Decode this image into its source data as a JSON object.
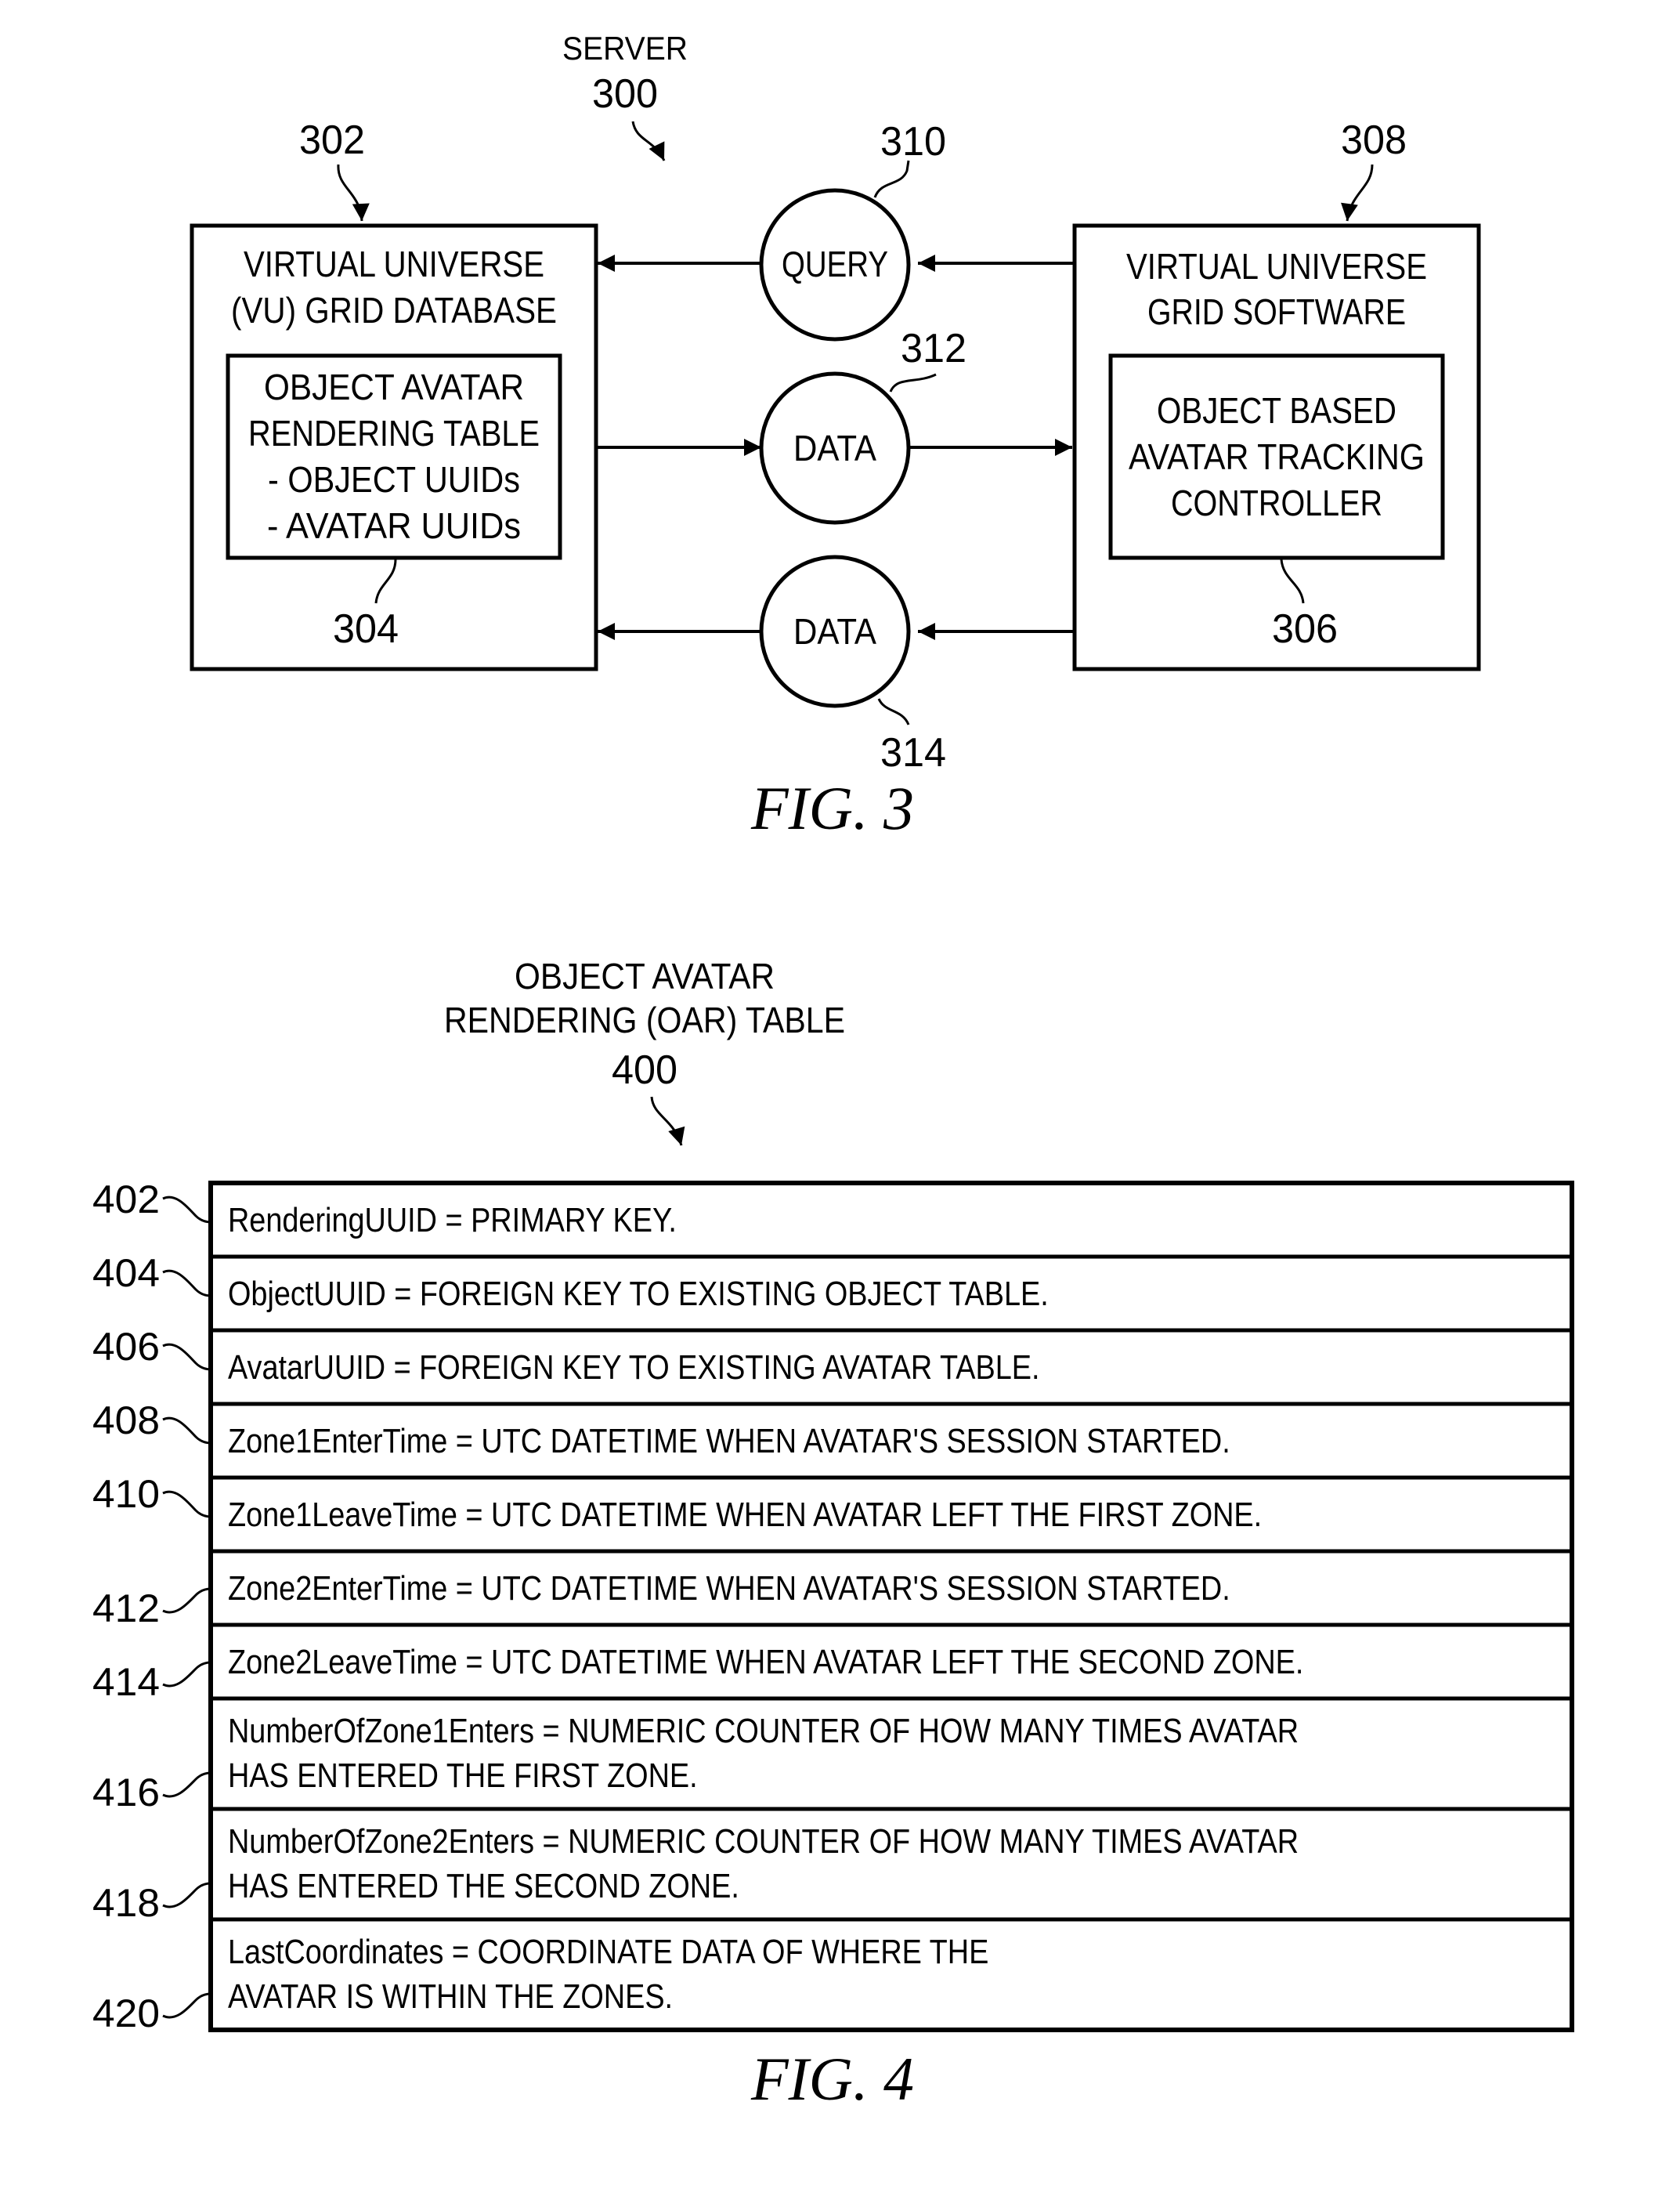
{
  "figure3": {
    "server_label": "SERVER",
    "server_ref": "300",
    "caption": "FIG. 3",
    "vu_grid_database": {
      "ref": "302",
      "title_lines": [
        "VIRTUAL UNIVERSE",
        "(VU) GRID DATABASE"
      ],
      "inner_table": {
        "ref": "304",
        "lines": [
          "OBJECT AVATAR",
          "RENDERING TABLE",
          "- OBJECT UUIDs",
          "- AVATAR UUIDs"
        ]
      }
    },
    "vu_grid_software": {
      "ref": "308",
      "title_lines": [
        "VIRTUAL UNIVERSE",
        "GRID SOFTWARE"
      ],
      "controller": {
        "ref": "306",
        "lines": [
          "OBJECT BASED",
          "AVATAR TRACKING",
          "CONTROLLER"
        ]
      }
    },
    "flows": [
      {
        "ref": "310",
        "label": "QUERY",
        "direction": "software-to-database"
      },
      {
        "ref": "312",
        "label": "DATA",
        "direction": "database-to-software"
      },
      {
        "ref": "314",
        "label": "DATA",
        "direction": "software-to-database"
      }
    ]
  },
  "figure4": {
    "title_lines": [
      "OBJECT AVATAR",
      "RENDERING (OAR) TABLE"
    ],
    "ref": "400",
    "caption": "FIG. 4",
    "rows": [
      {
        "ref": "402",
        "lines": [
          "RenderingUUID = PRIMARY KEY."
        ]
      },
      {
        "ref": "404",
        "lines": [
          "ObjectUUID = FOREIGN KEY TO EXISTING OBJECT TABLE."
        ]
      },
      {
        "ref": "406",
        "lines": [
          "AvatarUUID = FOREIGN KEY TO EXISTING AVATAR TABLE."
        ]
      },
      {
        "ref": "408",
        "lines": [
          "Zone1EnterTime = UTC DATETIME WHEN AVATAR'S SESSION STARTED."
        ]
      },
      {
        "ref": "410",
        "lines": [
          "Zone1LeaveTime = UTC DATETIME WHEN AVATAR LEFT THE FIRST ZONE."
        ]
      },
      {
        "ref": "412",
        "lines": [
          "Zone2EnterTime = UTC DATETIME WHEN AVATAR'S SESSION STARTED."
        ]
      },
      {
        "ref": "414",
        "lines": [
          "Zone2LeaveTime = UTC DATETIME WHEN AVATAR LEFT THE SECOND ZONE."
        ]
      },
      {
        "ref": "416",
        "lines": [
          "NumberOfZone1Enters = NUMERIC COUNTER OF HOW MANY TIMES AVATAR",
          "HAS ENTERED THE FIRST ZONE."
        ]
      },
      {
        "ref": "418",
        "lines": [
          "NumberOfZone2Enters = NUMERIC COUNTER OF HOW MANY TIMES AVATAR",
          "HAS ENTERED THE SECOND ZONE."
        ]
      },
      {
        "ref": "420",
        "lines": [
          "LastCoordinates = COORDINATE DATA OF WHERE THE",
          "AVATAR IS WITHIN THE ZONES."
        ]
      }
    ]
  }
}
